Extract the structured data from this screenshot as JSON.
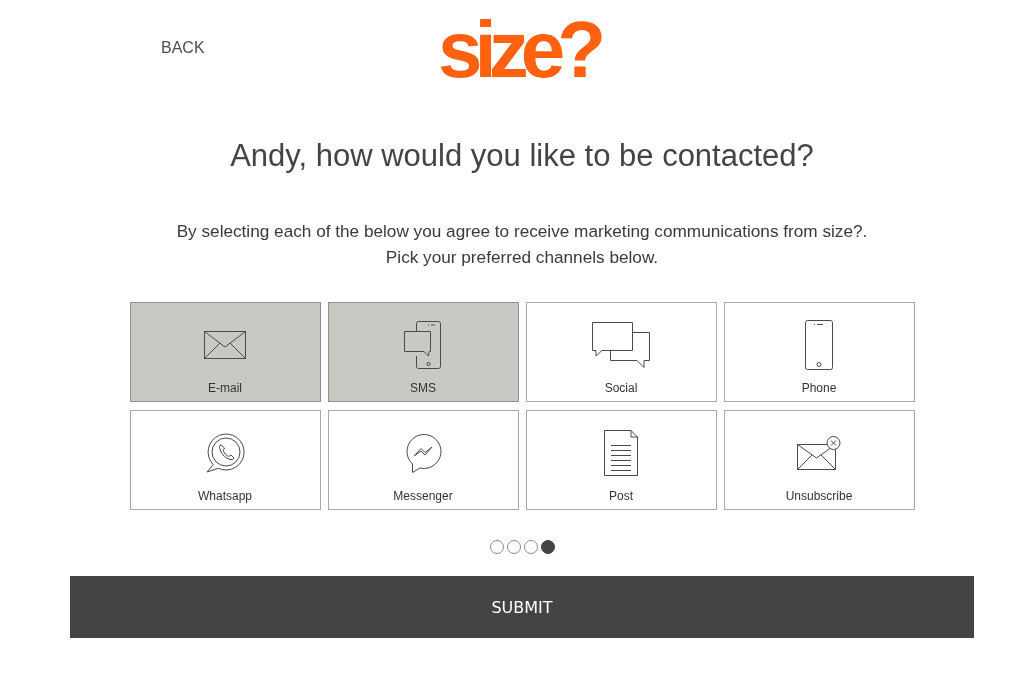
{
  "header": {
    "back_link": "BACK",
    "logo": "size?"
  },
  "heading": "Andy, how would you like to be contacted?",
  "intro": [
    "By selecting each of the below you agree to receive marketing communications from size?.",
    "Pick your preferred channels below."
  ],
  "channels": [
    {
      "label": "E-mail",
      "kind": "email",
      "selected": true
    },
    {
      "label": "SMS",
      "kind": "sms",
      "selected": true
    },
    {
      "label": "Social",
      "kind": "social",
      "selected": false
    },
    {
      "label": "Phone",
      "kind": "phone",
      "selected": false
    },
    {
      "label": "Whatsapp",
      "kind": "whatsapp",
      "selected": false
    },
    {
      "label": "Messenger",
      "kind": "messenger",
      "selected": false
    },
    {
      "label": "Post",
      "kind": "post",
      "selected": false
    },
    {
      "label": "Unsubscribe",
      "kind": "unsubscribe",
      "selected": false
    }
  ],
  "pager": [
    {
      "selected": false
    },
    {
      "selected": false
    },
    {
      "selected": false
    },
    {
      "selected": true
    }
  ],
  "submit_button": "SUBMIT"
}
